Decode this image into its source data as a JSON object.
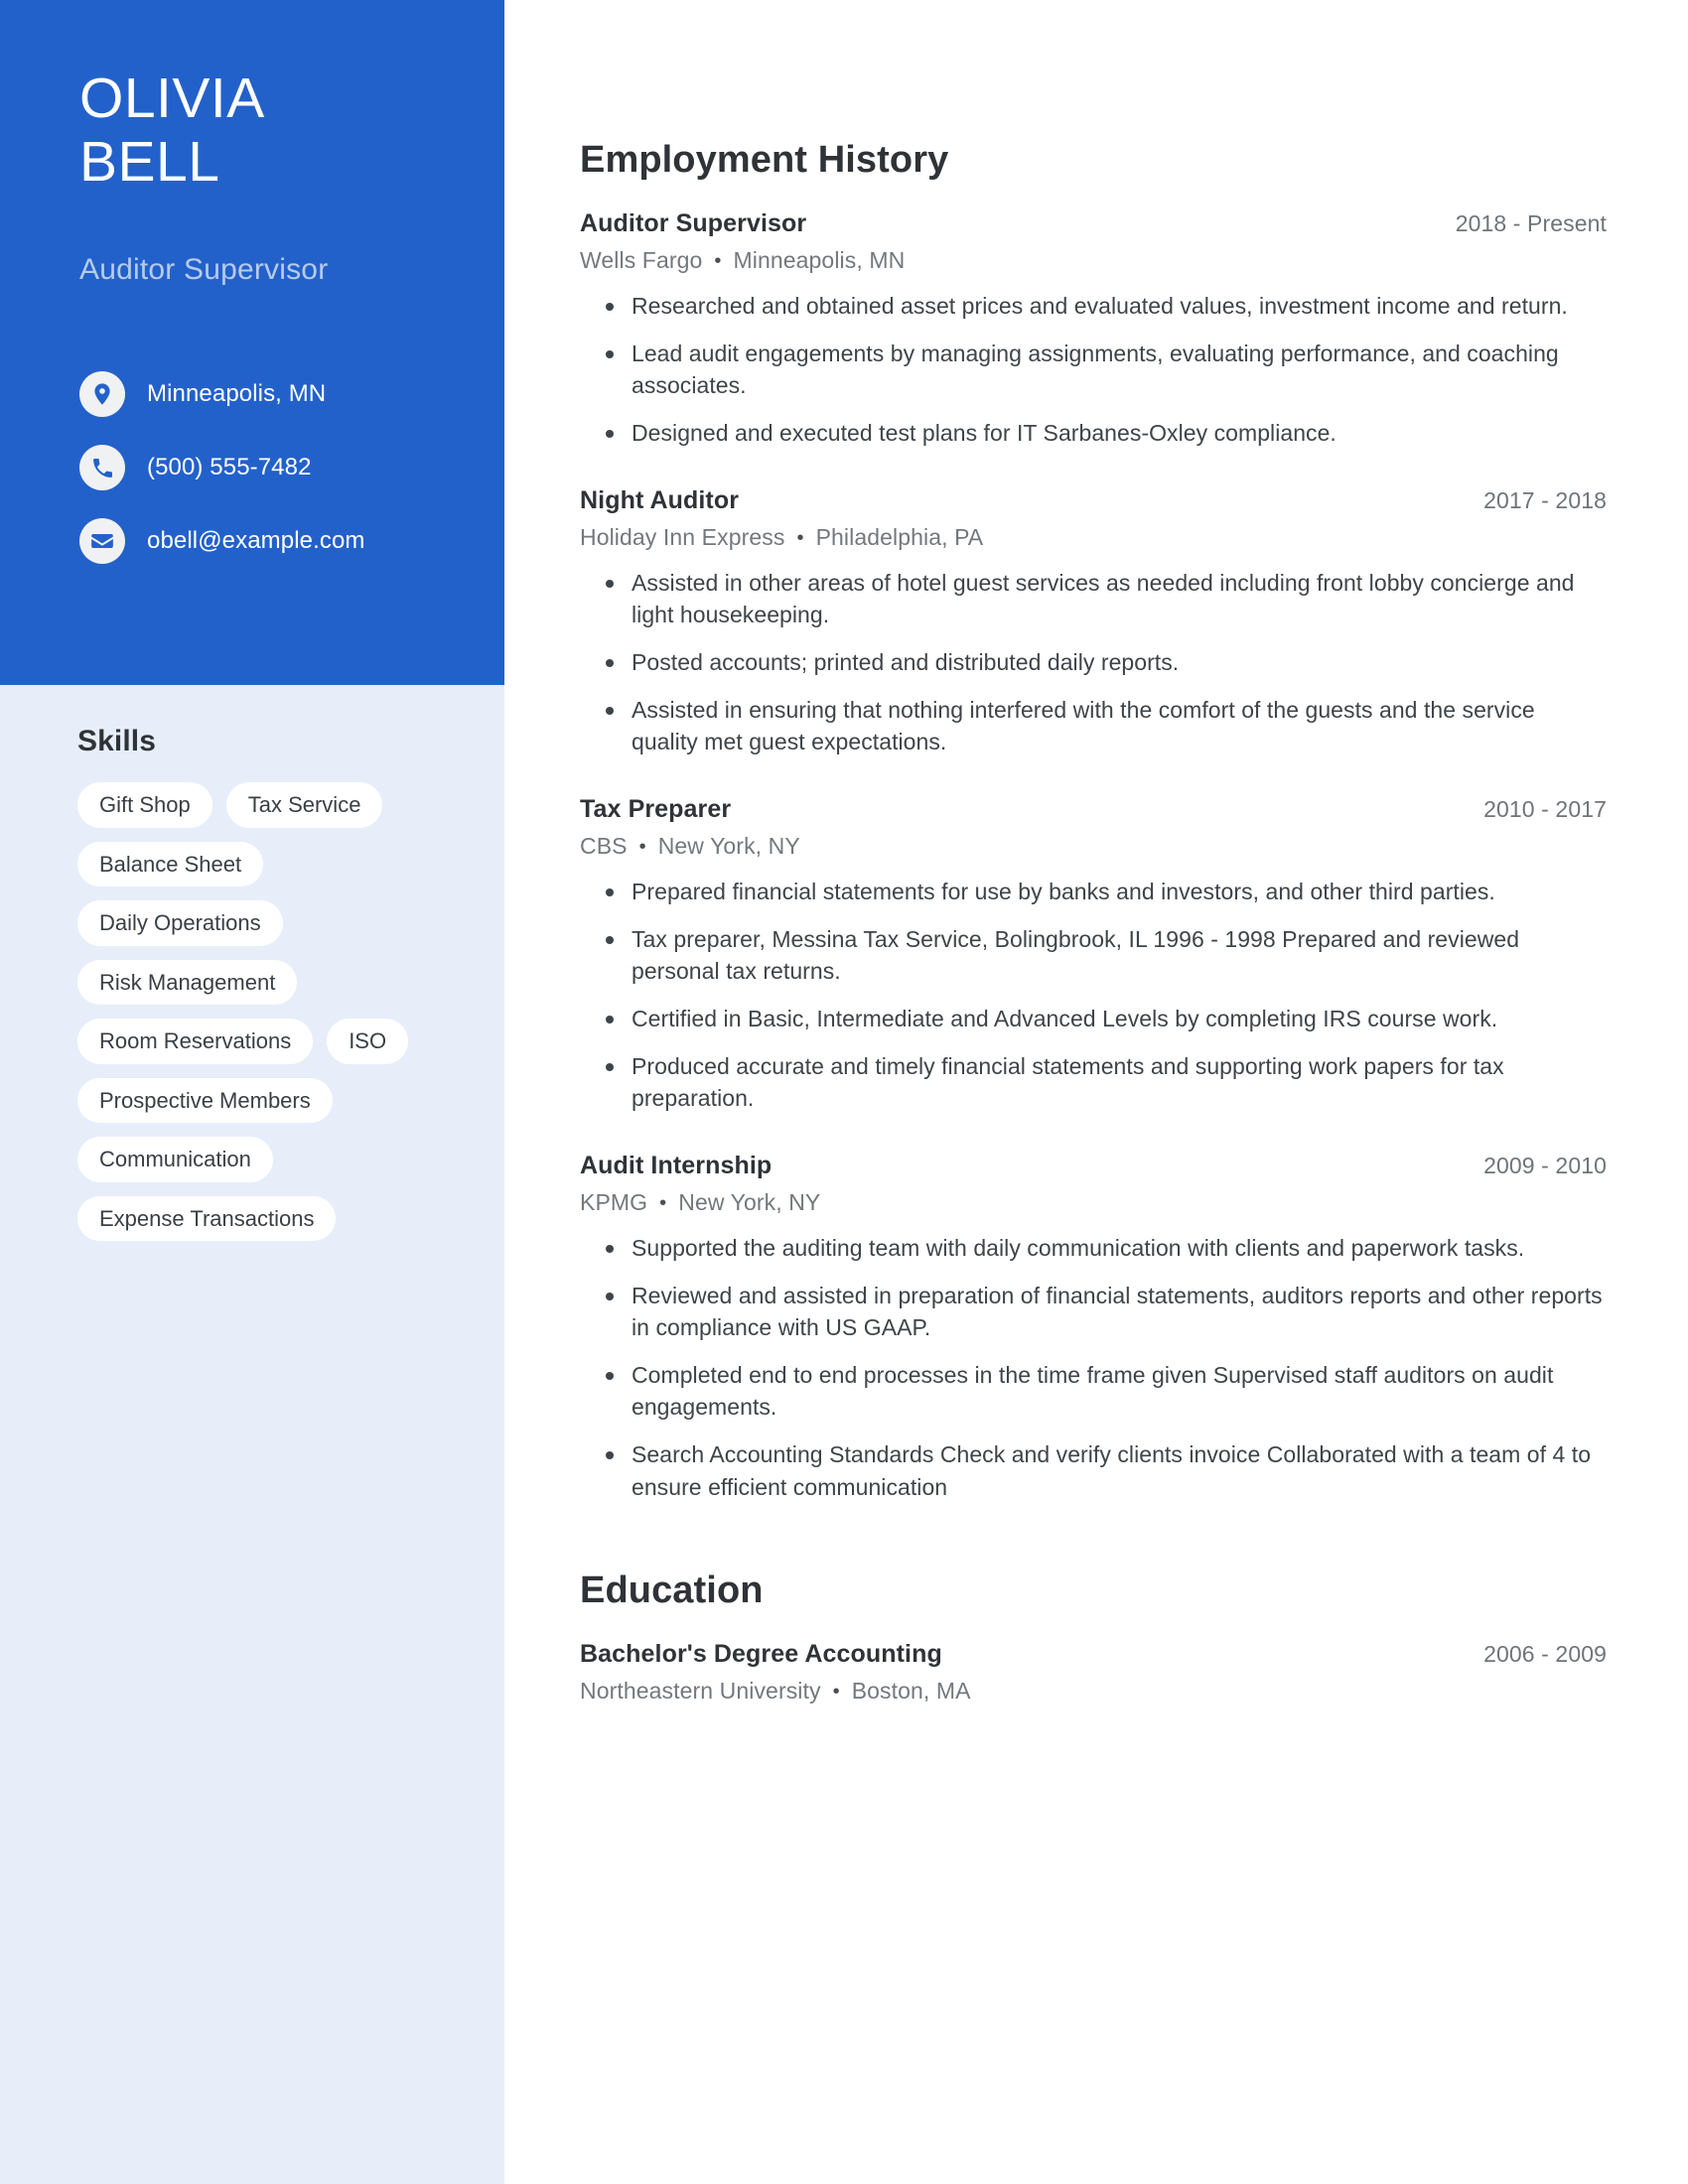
{
  "theme": {
    "primary_blue": "#2361ca",
    "sidebar_bg": "#e7eefa",
    "pill_bg": "#ffffff",
    "heading_color": "#2f3338",
    "muted_text": "#73787d",
    "subtitle_color": "#b6cbee"
  },
  "profile": {
    "first_name": "OLIVIA",
    "last_name": "BELL",
    "job_title": "Auditor Supervisor",
    "contact": [
      {
        "icon": "location-pin-icon",
        "value": "Minneapolis, MN"
      },
      {
        "icon": "phone-icon",
        "value": "(500) 555-7482"
      },
      {
        "icon": "email-icon",
        "value": "obell@example.com"
      }
    ]
  },
  "skills": {
    "heading": "Skills",
    "items": [
      "Gift Shop",
      "Tax Service",
      "Balance Sheet",
      "Daily Operations",
      "Risk Management",
      "Room Reservations",
      "ISO",
      "Prospective Members",
      "Communication",
      "Expense Transactions"
    ]
  },
  "employment": {
    "heading": "Employment History",
    "separator": "•",
    "entries": [
      {
        "title": "Auditor Supervisor",
        "date": "2018 - Present",
        "company": "Wells Fargo",
        "location": "Minneapolis, MN",
        "bullets": [
          "Researched and obtained asset prices and evaluated values, investment income and return.",
          "Lead audit engagements by managing assignments, evaluating performance, and coaching associates.",
          "Designed and executed test plans for IT Sarbanes-Oxley compliance."
        ]
      },
      {
        "title": "Night Auditor",
        "date": "2017 - 2018",
        "company": "Holiday Inn Express",
        "location": "Philadelphia, PA",
        "bullets": [
          "Assisted in other areas of hotel guest services as needed including front lobby concierge and light housekeeping.",
          "Posted accounts; printed and distributed daily reports.",
          "Assisted in ensuring that nothing interfered with the comfort of the guests and the service quality met guest expectations."
        ]
      },
      {
        "title": "Tax Preparer",
        "date": "2010 - 2017",
        "company": "CBS",
        "location": "New York, NY",
        "bullets": [
          "Prepared financial statements for use by banks and investors, and other third parties.",
          "Tax preparer, Messina Tax Service, Bolingbrook, IL 1996 - 1998 Prepared and reviewed personal tax returns.",
          "Certified in Basic, Intermediate and Advanced Levels by completing IRS course work.",
          "Produced accurate and timely financial statements and supporting work papers for tax preparation."
        ]
      },
      {
        "title": "Audit Internship",
        "date": "2009 - 2010",
        "company": "KPMG",
        "location": "New York, NY",
        "bullets": [
          "Supported the auditing team with daily communication with clients and paperwork tasks.",
          "Reviewed and assisted in preparation of financial statements, auditors reports and other reports in compliance with US GAAP.",
          "Completed end to end processes in the time frame given Supervised staff auditors on audit engagements.",
          "Search Accounting Standards Check and verify clients invoice Collaborated with a team of 4 to ensure efficient communication"
        ]
      }
    ]
  },
  "education": {
    "heading": "Education",
    "separator": "•",
    "entries": [
      {
        "title": "Bachelor's Degree Accounting",
        "date": "2006 - 2009",
        "school": "Northeastern University",
        "location": "Boston, MA"
      }
    ]
  }
}
